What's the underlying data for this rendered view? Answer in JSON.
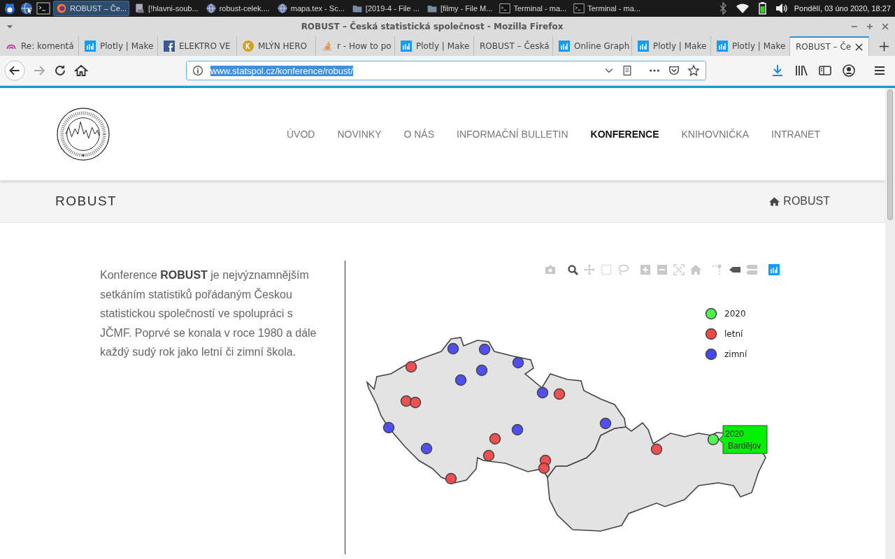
{
  "taskbar": {
    "windows": [
      {
        "label": "ROBUST – Če...",
        "kind": "firefox",
        "selected": true
      },
      {
        "label": "[!hlavni-soub...",
        "kind": "app",
        "selected": false
      },
      {
        "label": "robust-celek....",
        "kind": "globe",
        "selected": false
      },
      {
        "label": "mapa.tex - Sc...",
        "kind": "globe",
        "selected": false
      },
      {
        "label": "[2019-4 - File ...",
        "kind": "folder",
        "selected": false
      },
      {
        "label": "[filmy - File M...",
        "kind": "folder",
        "selected": false
      },
      {
        "label": "Terminal - ma...",
        "kind": "terminal",
        "selected": false
      },
      {
        "label": "Terminal - ma...",
        "kind": "terminal",
        "selected": false
      }
    ],
    "clock": "Pondělí, 03 úno 2020, 18:27"
  },
  "window": {
    "title": "ROBUST – Česká statistická společnost - Mozilla Firefox"
  },
  "tabs": [
    {
      "label": "Re: komentá",
      "kind": "ring",
      "selected": false
    },
    {
      "label": "Plotly | Make",
      "kind": "plotly",
      "selected": false
    },
    {
      "label": "ELEKTRO VE",
      "kind": "facebook",
      "selected": false
    },
    {
      "label": "MLÝN HERO",
      "kind": "coin",
      "selected": false
    },
    {
      "label": "r - How to po",
      "kind": "stack",
      "selected": false
    },
    {
      "label": "Plotly | Make",
      "kind": "plotly",
      "selected": false
    },
    {
      "label": "ROBUST – Česká",
      "kind": "none",
      "selected": false
    },
    {
      "label": "Online Graph",
      "kind": "plotly",
      "selected": false
    },
    {
      "label": "Plotly | Make",
      "kind": "plotly",
      "selected": false
    },
    {
      "label": "Plotly | Make",
      "kind": "plotly",
      "selected": false
    },
    {
      "label": "ROBUST – Če",
      "kind": "none",
      "selected": true
    }
  ],
  "address_bar": {
    "url": "www.statspol.cz/konference/robust/"
  },
  "site": {
    "nav": [
      {
        "label": "ÚVOD",
        "selected": false
      },
      {
        "label": "NOVINKY",
        "selected": false
      },
      {
        "label": "O NÁS",
        "selected": false
      },
      {
        "label": "INFORMAČNÍ BULLETIN",
        "selected": false
      },
      {
        "label": "KONFERENCE",
        "selected": true
      },
      {
        "label": "KNIHOVNIČKA",
        "selected": false
      },
      {
        "label": "INTRANET",
        "selected": false
      }
    ],
    "page_title": "ROBUST",
    "breadcrumb": "ROBUST"
  },
  "intro": "Konference **ROBUST** je nejvýznamnějším setkáním statistiků pořádaným Českou statistickou společností ve spolupráci s JČMF. Poprvé se konala v roce 1980 a dále každý sudý rok jako letní či zimní škola.",
  "map": {
    "legend": [
      {
        "label": "2020",
        "color": "#4cf24c"
      },
      {
        "label": "letní",
        "color": "#f24848"
      },
      {
        "label": "zimní",
        "color": "#4848f2"
      }
    ],
    "tooltip": [
      "2020",
      "Bardějov"
    ]
  }
}
